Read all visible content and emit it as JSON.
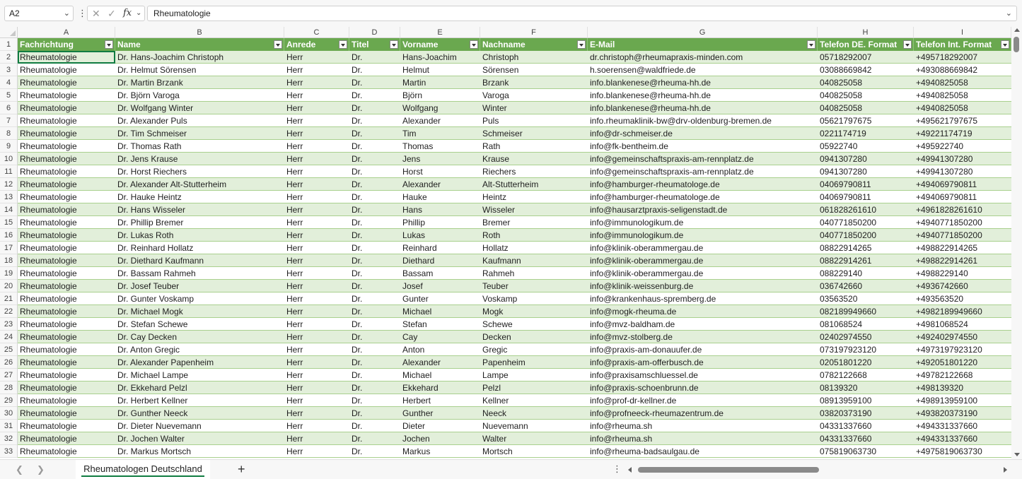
{
  "formula_bar": {
    "name_box": "A2",
    "formula": "Rheumatologie"
  },
  "columns": [
    "A",
    "B",
    "C",
    "D",
    "E",
    "F",
    "G",
    "H",
    "I"
  ],
  "table": {
    "headers": [
      "Fachrichtung",
      "Name",
      "Anrede",
      "Titel",
      "Vorname",
      "Nachname",
      "E-Mail",
      "Telefon DE. Format",
      "Telefon Int. Format"
    ],
    "rows": [
      [
        "Rheumatologie",
        "Dr. Hans-Joachim Christoph",
        "Herr",
        "Dr.",
        "Hans-Joachim",
        "Christoph",
        "dr.christoph@rheumapraxis-minden.com",
        "05718292007",
        "+495718292007"
      ],
      [
        "Rheumatologie",
        "Dr. Helmut Sörensen",
        "Herr",
        "Dr.",
        "Helmut",
        "Sörensen",
        "h.soerensen@waldfriede.de",
        "03088669842",
        "+493088669842"
      ],
      [
        "Rheumatologie",
        "Dr. Martin Brzank",
        "Herr",
        "Dr.",
        "Martin",
        "Brzank",
        "info.blankenese@rheuma-hh.de",
        "040825058",
        "+4940825058"
      ],
      [
        "Rheumatologie",
        "Dr. Björn Varoga",
        "Herr",
        "Dr.",
        "Björn",
        "Varoga",
        "info.blankenese@rheuma-hh.de",
        "040825058",
        "+4940825058"
      ],
      [
        "Rheumatologie",
        "Dr. Wolfgang Winter",
        "Herr",
        "Dr.",
        "Wolfgang",
        "Winter",
        "info.blankenese@rheuma-hh.de",
        "040825058",
        "+4940825058"
      ],
      [
        "Rheumatologie",
        "Dr. Alexander Puls",
        "Herr",
        "Dr.",
        "Alexander",
        "Puls",
        "info.rheumaklinik-bw@drv-oldenburg-bremen.de",
        "05621797675",
        "+495621797675"
      ],
      [
        "Rheumatologie",
        "Dr. Tim Schmeiser",
        "Herr",
        "Dr.",
        "Tim",
        "Schmeiser",
        "info@dr-schmeiser.de",
        "0221174719",
        "+49221174719"
      ],
      [
        "Rheumatologie",
        "Dr. Thomas Rath",
        "Herr",
        "Dr.",
        "Thomas",
        "Rath",
        "info@fk-bentheim.de",
        "05922740",
        "+495922740"
      ],
      [
        "Rheumatologie",
        "Dr. Jens Krause",
        "Herr",
        "Dr.",
        "Jens",
        "Krause",
        "info@gemeinschaftspraxis-am-rennplatz.de",
        "0941307280",
        "+49941307280"
      ],
      [
        "Rheumatologie",
        "Dr. Horst Riechers",
        "Herr",
        "Dr.",
        "Horst",
        "Riechers",
        "info@gemeinschaftspraxis-am-rennplatz.de",
        "0941307280",
        "+49941307280"
      ],
      [
        "Rheumatologie",
        "Dr. Alexander Alt-Stutterheim",
        "Herr",
        "Dr.",
        "Alexander",
        "Alt-Stutterheim",
        "info@hamburger-rheumatologe.de",
        "04069790811",
        "+494069790811"
      ],
      [
        "Rheumatologie",
        "Dr. Hauke Heintz",
        "Herr",
        "Dr.",
        "Hauke",
        "Heintz",
        "info@hamburger-rheumatologe.de",
        "04069790811",
        "+494069790811"
      ],
      [
        "Rheumatologie",
        "Dr. Hans Wisseler",
        "Herr",
        "Dr.",
        "Hans",
        "Wisseler",
        "info@hausarztpraxis-seligenstadt.de",
        "061828261610",
        "+4961828261610"
      ],
      [
        "Rheumatologie",
        "Dr. Phillip Bremer",
        "Herr",
        "Dr.",
        "Phillip",
        "Bremer",
        "info@immunologikum.de",
        "040771850200",
        "+4940771850200"
      ],
      [
        "Rheumatologie",
        "Dr. Lukas Roth",
        "Herr",
        "Dr.",
        "Lukas",
        "Roth",
        "info@immunologikum.de",
        "040771850200",
        "+4940771850200"
      ],
      [
        "Rheumatologie",
        "Dr. Reinhard Hollatz",
        "Herr",
        "Dr.",
        "Reinhard",
        "Hollatz",
        "info@klinik-oberammergau.de",
        "08822914265",
        "+498822914265"
      ],
      [
        "Rheumatologie",
        "Dr. Diethard Kaufmann",
        "Herr",
        "Dr.",
        "Diethard",
        "Kaufmann",
        "info@klinik-oberammergau.de",
        "08822914261",
        "+498822914261"
      ],
      [
        "Rheumatologie",
        "Dr. Bassam Rahmeh",
        "Herr",
        "Dr.",
        "Bassam",
        "Rahmeh",
        "info@klinik-oberammergau.de",
        "088229140",
        "+4988229140"
      ],
      [
        "Rheumatologie",
        "Dr. Josef Teuber",
        "Herr",
        "Dr.",
        "Josef",
        "Teuber",
        "info@klinik-weissenburg.de",
        "036742660",
        "+4936742660"
      ],
      [
        "Rheumatologie",
        "Dr. Gunter Voskamp",
        "Herr",
        "Dr.",
        "Gunter",
        "Voskamp",
        "info@krankenhaus-spremberg.de",
        "03563520",
        "+493563520"
      ],
      [
        "Rheumatologie",
        "Dr. Michael Mogk",
        "Herr",
        "Dr.",
        "Michael",
        "Mogk",
        "info@mogk-rheuma.de",
        "082189949660",
        "+4982189949660"
      ],
      [
        "Rheumatologie",
        "Dr. Stefan Schewe",
        "Herr",
        "Dr.",
        "Stefan",
        "Schewe",
        "info@mvz-baldham.de",
        "081068524",
        "+4981068524"
      ],
      [
        "Rheumatologie",
        "Dr. Cay Decken",
        "Herr",
        "Dr.",
        "Cay",
        "Decken",
        "info@mvz-stolberg.de",
        "02402974550",
        "+492402974550"
      ],
      [
        "Rheumatologie",
        "Dr. Anton Gregic",
        "Herr",
        "Dr.",
        "Anton",
        "Gregic",
        "info@praxis-am-donauufer.de",
        "073197923120",
        "+4973197923120"
      ],
      [
        "Rheumatologie",
        "Dr. Alexander Papenheim",
        "Herr",
        "Dr.",
        "Alexander",
        "Papenheim",
        "info@praxis-am-offerbusch.de",
        "02051801220",
        "+492051801220"
      ],
      [
        "Rheumatologie",
        "Dr. Michael Lampe",
        "Herr",
        "Dr.",
        "Michael",
        "Lampe",
        "info@praxisamschluessel.de",
        "0782122668",
        "+49782122668"
      ],
      [
        "Rheumatologie",
        "Dr. Ekkehard Pelzl",
        "Herr",
        "Dr.",
        "Ekkehard",
        "Pelzl",
        "info@praxis-schoenbrunn.de",
        "08139320",
        "+498139320"
      ],
      [
        "Rheumatologie",
        "Dr. Herbert Kellner",
        "Herr",
        "Dr.",
        "Herbert",
        "Kellner",
        "info@prof-dr-kellner.de",
        "08913959100",
        "+498913959100"
      ],
      [
        "Rheumatologie",
        "Dr. Gunther Neeck",
        "Herr",
        "Dr.",
        "Gunther",
        "Neeck",
        "info@profneeck-rheumazentrum.de",
        "03820373190",
        "+493820373190"
      ],
      [
        "Rheumatologie",
        "Dr. Dieter Nuevemann",
        "Herr",
        "Dr.",
        "Dieter",
        "Nuevemann",
        "info@rheuma.sh",
        "04331337660",
        "+494331337660"
      ],
      [
        "Rheumatologie",
        "Dr. Jochen Walter",
        "Herr",
        "Dr.",
        "Jochen",
        "Walter",
        "info@rheuma.sh",
        "04331337660",
        "+494331337660"
      ],
      [
        "Rheumatologie",
        "Dr. Markus Mortsch",
        "Herr",
        "Dr.",
        "Markus",
        "Mortsch",
        "info@rheuma-badsaulgau.de",
        "075819063730",
        "+4975819063730"
      ]
    ]
  },
  "sheet_tabs": [
    "Rheumatologen Deutschland"
  ],
  "icons": {
    "cancel": "close-icon",
    "confirm": "check-icon",
    "function": "fx-icon",
    "add_sheet": "plus-icon"
  },
  "colors": {
    "header_bg": "#6aa84f",
    "band_bg": "#e2efda",
    "accent": "#107c41"
  }
}
